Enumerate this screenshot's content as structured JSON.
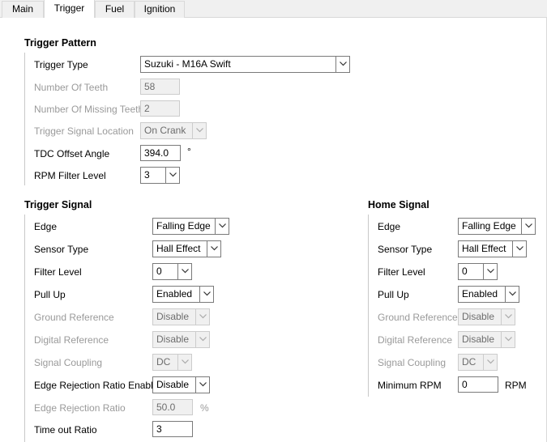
{
  "tabs": [
    "Main",
    "Trigger",
    "Fuel",
    "Ignition"
  ],
  "trigger_pattern": {
    "title": "Trigger Pattern",
    "trigger_type_label": "Trigger Type",
    "trigger_type_value": "Suzuki - M16A Swift",
    "num_teeth_label": "Number Of Teeth",
    "num_teeth_value": "58",
    "num_missing_label": "Number Of Missing Teeth",
    "num_missing_value": "2",
    "signal_location_label": "Trigger Signal Location",
    "signal_location_value": "On Crank",
    "tdc_offset_label": "TDC Offset Angle",
    "tdc_offset_value": "394.0",
    "tdc_offset_unit": "°",
    "rpm_filter_label": "RPM Filter Level",
    "rpm_filter_value": "3"
  },
  "trigger_signal": {
    "title": "Trigger Signal",
    "edge_label": "Edge",
    "edge_value": "Falling Edge",
    "sensor_type_label": "Sensor Type",
    "sensor_type_value": "Hall Effect",
    "filter_level_label": "Filter Level",
    "filter_level_value": "0",
    "pull_up_label": "Pull Up",
    "pull_up_value": "Enabled",
    "ground_ref_label": "Ground Reference",
    "ground_ref_value": "Disable",
    "digital_ref_label": "Digital Reference",
    "digital_ref_value": "Disable",
    "signal_coupling_label": "Signal Coupling",
    "signal_coupling_value": "DC",
    "edge_rej_enable_label": "Edge Rejection Ratio Enable",
    "edge_rej_enable_value": "Disable",
    "edge_rej_ratio_label": "Edge Rejection Ratio",
    "edge_rej_ratio_value": "50.0",
    "edge_rej_ratio_unit": "%",
    "timeout_label": "Time out Ratio",
    "timeout_value": "3"
  },
  "home_signal": {
    "title": "Home Signal",
    "edge_label": "Edge",
    "edge_value": "Falling Edge",
    "sensor_type_label": "Sensor Type",
    "sensor_type_value": "Hall Effect",
    "filter_level_label": "Filter Level",
    "filter_level_value": "0",
    "pull_up_label": "Pull Up",
    "pull_up_value": "Enabled",
    "ground_ref_label": "Ground Reference",
    "ground_ref_value": "Disable",
    "digital_ref_label": "Digital Reference",
    "digital_ref_value": "Disable",
    "signal_coupling_label": "Signal Coupling",
    "signal_coupling_value": "DC",
    "min_rpm_label": "Minimum RPM",
    "min_rpm_value": "0",
    "min_rpm_unit": "RPM"
  }
}
